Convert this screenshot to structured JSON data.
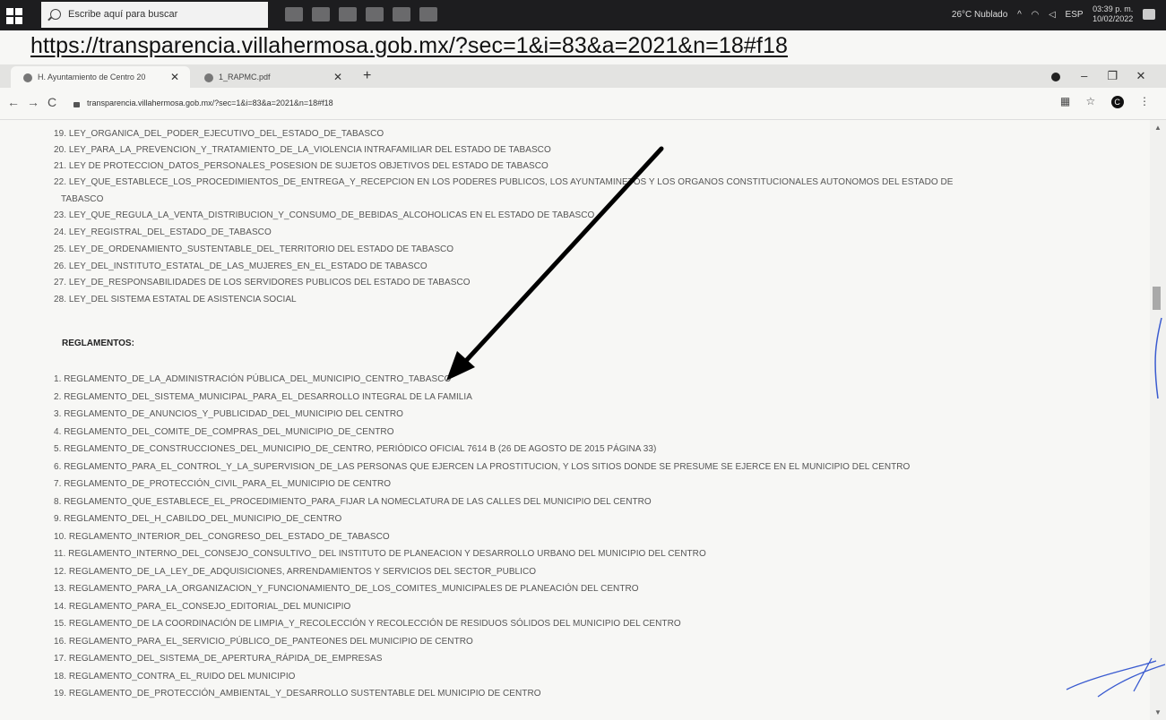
{
  "taskbar": {
    "search_placeholder": "Escribe aquí para buscar",
    "weather": "26°C Nublado",
    "language": "ESP",
    "time": "03:39 p. m.",
    "date": "10/02/2022"
  },
  "annotation_url": "https://transparencia.villahermosa.gob.mx/?sec=1&i=83&a=2021&n=18#f18",
  "browser": {
    "tabs": [
      {
        "label": "H. Ayuntamiento de Centro 20",
        "active": true
      },
      {
        "label": "1_RAPMC.pdf",
        "active": false
      }
    ],
    "new_tab": "+",
    "address": "transparencia.villahermosa.gob.mx/?sec=1&i=83&a=2021&n=18#f18",
    "avatar_letter": "C"
  },
  "laws": [
    "19. LEY_ORGANICA_DEL_PODER_EJECUTIVO_DEL_ESTADO_DE_TABASCO",
    "20. LEY_PARA_LA_PREVENCION_Y_TRATAMIENTO_DE_LA_VIOLENCIA INTRAFAMILIAR DEL ESTADO DE TABASCO",
    "21. LEY DE PROTECCION_DATOS_PERSONALES_POSESION DE SUJETOS OBJETIVOS DEL ESTADO DE TABASCO",
    "22. LEY_QUE_ESTABLECE_LOS_PROCEDIMIENTOS_DE_ENTREGA_Y_RECEPCION EN LOS PODERES PUBLICOS, LOS AYUNTAMINETOS Y LOS ORGANOS CONSTITUCIONALES AUTONOMOS DEL ESTADO DE",
    "TABASCO",
    "23. LEY_QUE_REGULA_LA_VENTA_DISTRIBUCION_Y_CONSUMO_DE_BEBIDAS_ALCOHOLICAS EN EL ESTADO DE TABASCO",
    "24. LEY_REGISTRAL_DEL_ESTADO_DE_TABASCO",
    "25. LEY_DE_ORDENAMIENTO_SUSTENTABLE_DEL_TERRITORIO DEL ESTADO DE TABASCO",
    "26. LEY_DEL_INSTITUTO_ESTATAL_DE_LAS_MUJERES_EN_EL_ESTADO DE TABASCO",
    "27. LEY_DE_RESPONSABILIDADES DE LOS SERVIDORES PUBLICOS DEL ESTADO DE TABASCO",
    "28. LEY_DEL SISTEMA ESTATAL DE ASISTENCIA SOCIAL"
  ],
  "reglamentos_heading": "REGLAMENTOS:",
  "reglamentos": [
    "1. REGLAMENTO_DE_LA_ADMINISTRACIÓN PÚBLICA_DEL_MUNICIPIO_CENTRO_TABASCO",
    "2. REGLAMENTO_DEL_SISTEMA_MUNICIPAL_PARA_EL_DESARROLLO INTEGRAL DE LA FAMILIA",
    "3. REGLAMENTO_DE_ANUNCIOS_Y_PUBLICIDAD_DEL_MUNICIPIO DEL CENTRO",
    "4. REGLAMENTO_DEL_COMITE_DE_COMPRAS_DEL_MUNICIPIO_DE_CENTRO",
    "5. REGLAMENTO_DE_CONSTRUCCIONES_DEL_MUNICIPIO_DE_CENTRO, PERIÓDICO OFICIAL 7614 B (26 DE AGOSTO DE 2015 PÁGINA 33)",
    "6. REGLAMENTO_PARA_EL_CONTROL_Y_LA_SUPERVISION_DE_LAS PERSONAS QUE EJERCEN LA PROSTITUCION, Y LOS SITIOS DONDE SE PRESUME SE EJERCE EN EL MUNICIPIO DEL CENTRO",
    "7. REGLAMENTO_DE_PROTECCIÓN_CIVIL_PARA_EL_MUNICIPIO DE CENTRO",
    "8. REGLAMENTO_QUE_ESTABLECE_EL_PROCEDIMIENTO_PARA_FIJAR LA NOMECLATURA DE LAS CALLES DEL MUNICIPIO DEL CENTRO",
    "9. REGLAMENTO_DEL_H_CABILDO_DEL_MUNICIPIO_DE_CENTRO",
    "10. REGLAMENTO_INTERIOR_DEL_CONGRESO_DEL_ESTADO_DE_TABASCO",
    "11. REGLAMENTO_INTERNO_DEL_CONSEJO_CONSULTIVO_ DEL INSTITUTO DE PLANEACION Y DESARROLLO URBANO DEL MUNICIPIO DEL CENTRO",
    "12. REGLAMENTO_DE_LA_LEY_DE_ADQUISICIONES, ARRENDAMIENTOS Y SERVICIOS DEL SECTOR_PUBLICO",
    "13. REGLAMENTO_PARA_LA_ORGANIZACION_Y_FUNCIONAMIENTO_DE_LOS_COMITES_MUNICIPALES DE PLANEACIÓN DEL CENTRO",
    "14. REGLAMENTO_PARA_EL_CONSEJO_EDITORIAL_DEL MUNICIPIO",
    "15. REGLAMENTO_DE LA COORDINACIÓN DE LIMPIA_Y_RECOLECCIÓN Y RECOLECCIÓN DE RESIDUOS SÓLIDOS DEL MUNICIPIO DEL CENTRO",
    "16. REGLAMENTO_PARA_EL_SERVICIO_PÚBLICO_DE_PANTEONES DEL MUNICIPIO DE CENTRO",
    "17. REGLAMENTO_DEL_SISTEMA_DE_APERTURA_RÁPIDA_DE_EMPRESAS",
    "18. REGLAMENTO_CONTRA_EL_RUIDO DEL MUNICIPIO",
    "19. REGLAMENTO_DE_PROTECCIÓN_AMBIENTAL_Y_DESARROLLO SUSTENTABLE DEL MUNICIPIO DE CENTRO"
  ],
  "colors": {
    "taskbar": "#1d1d1f",
    "page_background": "#f7f7f5",
    "annotation_arrow": "#000000",
    "signature": "#3a5bd0"
  }
}
